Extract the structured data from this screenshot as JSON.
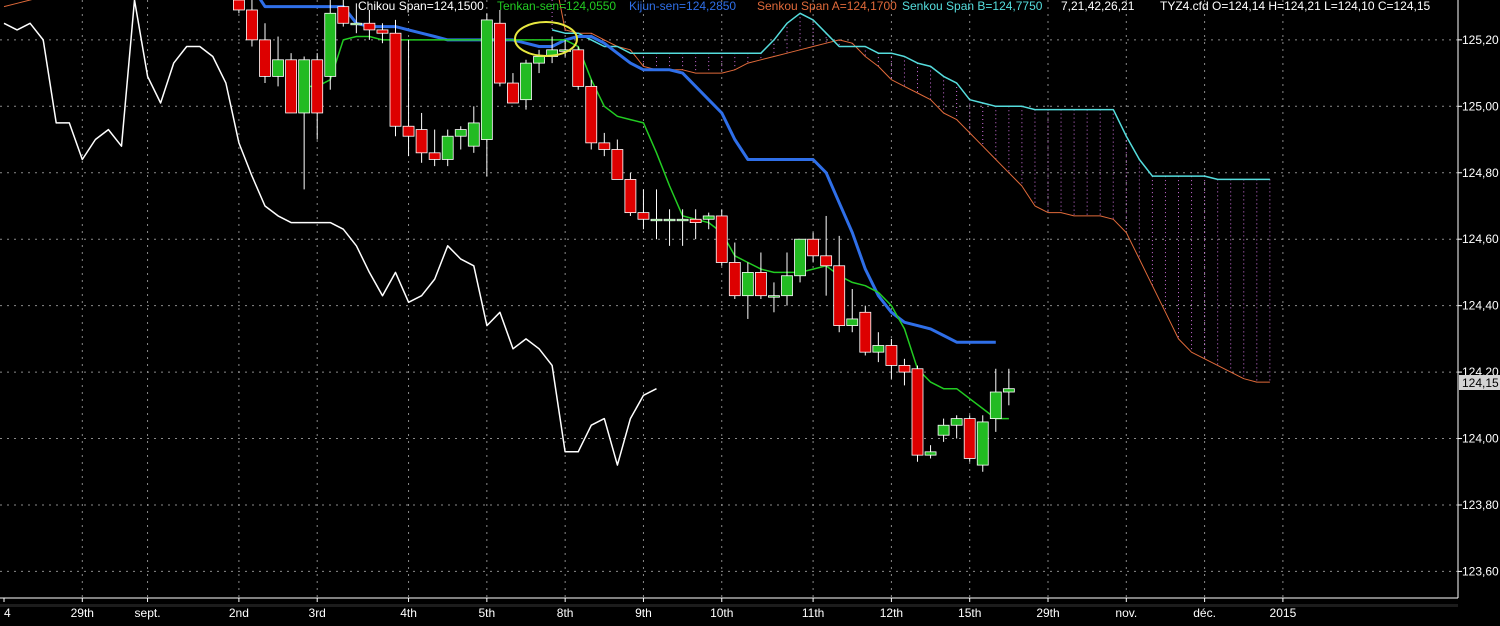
{
  "header": {
    "chikou": "Chikou Span=124,1500",
    "tenkan": "Tenkan-sen=124,0550",
    "kijun": "Kijun-sen=124,2850",
    "senkou_a": "Senkou Span A=124,1700",
    "senkou_b": "Senkou Span B=124,7750",
    "params": "7,21,42,26,21",
    "ohlc": "TYZ4.cfd O=124,14 H=124,21 L=124,10 C=124,15"
  },
  "colors": {
    "background": "#000000",
    "grid": "#8a8a8a",
    "bull": "#22bb22",
    "bear": "#dd0000",
    "chikou": "#ffffff",
    "tenkan": "#22cc22",
    "kijun": "#2f6fe8",
    "senkou_a": "#e06a3a",
    "senkou_b": "#55dddd",
    "cloud_hatch": "#d070e0",
    "annotation": "#e8e840"
  },
  "chart_data": {
    "type": "candlestick",
    "ylim": [
      123.52,
      125.32
    ],
    "y_ticks": [
      "125,20",
      "125,00",
      "124,80",
      "124,60",
      "124,40",
      "124,20",
      "124,00",
      "123,80",
      "123,60"
    ],
    "y_tick_values": [
      125.2,
      125.0,
      124.8,
      124.6,
      124.4,
      124.2,
      124.0,
      123.8,
      123.6
    ],
    "current_price_label": "124,15",
    "current_price": 124.15,
    "x_labels": [
      "4",
      "29th",
      "sept.",
      "2nd",
      "3rd",
      "4th",
      "5th",
      "8th",
      "9th",
      "10th",
      "11th",
      "12th",
      "15th",
      "29th",
      "nov.",
      "déc.",
      "2015"
    ],
    "x_label_slots": [
      0,
      6,
      11,
      18,
      24,
      31,
      37,
      43,
      49,
      55,
      62,
      68,
      74,
      80,
      86,
      92,
      98
    ],
    "candles": [
      {
        "slot": 18,
        "o": 125.32,
        "h": 125.32,
        "l": 125.28,
        "c": 125.29
      },
      {
        "slot": 19,
        "o": 125.29,
        "h": 125.32,
        "l": 125.18,
        "c": 125.2
      },
      {
        "slot": 20,
        "o": 125.2,
        "h": 125.25,
        "l": 125.07,
        "c": 125.09
      },
      {
        "slot": 21,
        "o": 125.09,
        "h": 125.21,
        "l": 125.06,
        "c": 125.14
      },
      {
        "slot": 22,
        "o": 125.14,
        "h": 125.16,
        "l": 124.98,
        "c": 124.98
      },
      {
        "slot": 23,
        "o": 124.98,
        "h": 125.15,
        "l": 124.75,
        "c": 125.14
      },
      {
        "slot": 24,
        "o": 125.14,
        "h": 125.16,
        "l": 124.9,
        "c": 124.98
      },
      {
        "slot": 25,
        "o": 125.09,
        "h": 125.32,
        "l": 125.05,
        "c": 125.28
      },
      {
        "slot": 26,
        "o": 125.3,
        "h": 125.32,
        "l": 125.24,
        "c": 125.25
      },
      {
        "slot": 27,
        "o": 125.25,
        "h": 125.31,
        "l": 125.22,
        "c": 125.25
      },
      {
        "slot": 28,
        "o": 125.25,
        "h": 125.29,
        "l": 125.2,
        "c": 125.23
      },
      {
        "slot": 29,
        "o": 125.23,
        "h": 125.25,
        "l": 125.19,
        "c": 125.22
      },
      {
        "slot": 30,
        "o": 125.22,
        "h": 125.26,
        "l": 124.91,
        "c": 124.94
      },
      {
        "slot": 31,
        "o": 124.94,
        "h": 125.2,
        "l": 124.85,
        "c": 124.91
      },
      {
        "slot": 32,
        "o": 124.93,
        "h": 124.98,
        "l": 124.83,
        "c": 124.86
      },
      {
        "slot": 33,
        "o": 124.86,
        "h": 124.93,
        "l": 124.82,
        "c": 124.84
      },
      {
        "slot": 34,
        "o": 124.84,
        "h": 124.93,
        "l": 124.82,
        "c": 124.91
      },
      {
        "slot": 35,
        "o": 124.91,
        "h": 124.94,
        "l": 124.87,
        "c": 124.93
      },
      {
        "slot": 36,
        "o": 124.88,
        "h": 125.0,
        "l": 124.86,
        "c": 124.95
      },
      {
        "slot": 37,
        "o": 124.9,
        "h": 125.28,
        "l": 124.79,
        "c": 125.26
      },
      {
        "slot": 38,
        "o": 125.25,
        "h": 125.29,
        "l": 125.06,
        "c": 125.07
      },
      {
        "slot": 39,
        "o": 125.07,
        "h": 125.1,
        "l": 125.01,
        "c": 125.01
      },
      {
        "slot": 40,
        "o": 125.02,
        "h": 125.14,
        "l": 124.99,
        "c": 125.13
      },
      {
        "slot": 41,
        "o": 125.13,
        "h": 125.17,
        "l": 125.1,
        "c": 125.15
      },
      {
        "slot": 42,
        "o": 125.15,
        "h": 125.21,
        "l": 125.13,
        "c": 125.17
      },
      {
        "slot": 43,
        "o": 125.17,
        "h": 125.2,
        "l": 125.15,
        "c": 125.17
      },
      {
        "slot": 44,
        "o": 125.17,
        "h": 125.18,
        "l": 125.05,
        "c": 125.06
      },
      {
        "slot": 45,
        "o": 125.06,
        "h": 125.08,
        "l": 124.87,
        "c": 124.89
      },
      {
        "slot": 46,
        "o": 124.89,
        "h": 124.92,
        "l": 124.85,
        "c": 124.87
      },
      {
        "slot": 47,
        "o": 124.87,
        "h": 124.9,
        "l": 124.78,
        "c": 124.78
      },
      {
        "slot": 48,
        "o": 124.78,
        "h": 124.8,
        "l": 124.67,
        "c": 124.68
      },
      {
        "slot": 49,
        "o": 124.68,
        "h": 124.75,
        "l": 124.63,
        "c": 124.66
      },
      {
        "slot": 50,
        "o": 124.66,
        "h": 124.75,
        "l": 124.6,
        "c": 124.66
      },
      {
        "slot": 51,
        "o": 124.66,
        "h": 124.69,
        "l": 124.58,
        "c": 124.66
      },
      {
        "slot": 52,
        "o": 124.66,
        "h": 124.69,
        "l": 124.58,
        "c": 124.66
      },
      {
        "slot": 53,
        "o": 124.66,
        "h": 124.69,
        "l": 124.6,
        "c": 124.65
      },
      {
        "slot": 54,
        "o": 124.66,
        "h": 124.68,
        "l": 124.63,
        "c": 124.67
      },
      {
        "slot": 55,
        "o": 124.67,
        "h": 124.69,
        "l": 124.52,
        "c": 124.53
      },
      {
        "slot": 56,
        "o": 124.53,
        "h": 124.59,
        "l": 124.42,
        "c": 124.43
      },
      {
        "slot": 57,
        "o": 124.43,
        "h": 124.53,
        "l": 124.36,
        "c": 124.5
      },
      {
        "slot": 58,
        "o": 124.5,
        "h": 124.56,
        "l": 124.42,
        "c": 124.43
      },
      {
        "slot": 59,
        "o": 124.43,
        "h": 124.47,
        "l": 124.38,
        "c": 124.43
      },
      {
        "slot": 60,
        "o": 124.43,
        "h": 124.56,
        "l": 124.4,
        "c": 124.49
      },
      {
        "slot": 61,
        "o": 124.49,
        "h": 124.6,
        "l": 124.47,
        "c": 124.6
      },
      {
        "slot": 62,
        "o": 124.6,
        "h": 124.62,
        "l": 124.53,
        "c": 124.55
      },
      {
        "slot": 63,
        "o": 124.55,
        "h": 124.67,
        "l": 124.43,
        "c": 124.52
      },
      {
        "slot": 64,
        "o": 124.52,
        "h": 124.61,
        "l": 124.32,
        "c": 124.34
      },
      {
        "slot": 65,
        "o": 124.34,
        "h": 124.45,
        "l": 124.32,
        "c": 124.36
      },
      {
        "slot": 66,
        "o": 124.38,
        "h": 124.4,
        "l": 124.25,
        "c": 124.26
      },
      {
        "slot": 67,
        "o": 124.26,
        "h": 124.32,
        "l": 124.23,
        "c": 124.28
      },
      {
        "slot": 68,
        "o": 124.28,
        "h": 124.3,
        "l": 124.18,
        "c": 124.22
      },
      {
        "slot": 69,
        "o": 124.22,
        "h": 124.24,
        "l": 124.16,
        "c": 124.2
      },
      {
        "slot": 70,
        "o": 124.21,
        "h": 124.22,
        "l": 123.93,
        "c": 123.95
      },
      {
        "slot": 71,
        "o": 123.95,
        "h": 123.98,
        "l": 123.94,
        "c": 123.96
      },
      {
        "slot": 72,
        "o": 124.01,
        "h": 124.06,
        "l": 123.99,
        "c": 124.04
      },
      {
        "slot": 73,
        "o": 124.04,
        "h": 124.07,
        "l": 124.0,
        "c": 124.06
      },
      {
        "slot": 74,
        "o": 124.06,
        "h": 124.07,
        "l": 123.93,
        "c": 123.94
      },
      {
        "slot": 75,
        "o": 123.92,
        "h": 124.07,
        "l": 123.9,
        "c": 124.05
      },
      {
        "slot": 76,
        "o": 124.06,
        "h": 124.21,
        "l": 124.02,
        "c": 124.14
      },
      {
        "slot": 77,
        "o": 124.14,
        "h": 124.21,
        "l": 124.1,
        "c": 124.15
      }
    ],
    "chikou": {
      "start_slot": 0,
      "values": [
        125.25,
        125.23,
        125.25,
        125.2,
        124.95,
        124.95,
        124.84,
        124.9,
        124.93,
        124.88,
        125.32,
        125.09,
        125.01,
        125.13,
        125.18,
        125.18,
        125.15,
        125.07,
        124.89,
        124.79,
        124.7,
        124.67,
        124.65,
        124.65,
        124.65,
        124.65,
        124.63,
        124.58,
        124.5,
        124.43,
        124.5,
        124.41,
        124.43,
        124.48,
        124.58,
        124.54,
        124.52,
        124.34,
        124.38,
        124.27,
        124.3,
        124.27,
        124.22,
        123.96,
        123.96,
        124.04,
        124.06,
        123.92,
        124.06,
        124.13,
        124.15
      ]
    },
    "tenkan": {
      "start_slot": 23,
      "values": [
        125.06,
        125.06,
        125.08,
        125.2,
        125.21,
        125.21,
        125.2,
        125.2,
        125.2,
        125.2,
        125.2,
        125.2,
        125.2,
        125.2,
        125.2,
        125.2,
        125.2,
        125.2,
        125.2,
        125.2,
        125.2,
        125.18,
        125.08,
        125.0,
        124.97,
        124.96,
        124.95,
        124.86,
        124.76,
        124.67,
        124.66,
        124.65,
        124.62,
        124.55,
        124.53,
        124.51,
        124.5,
        124.5,
        124.5,
        124.51,
        124.52,
        124.49,
        124.47,
        124.46,
        124.44,
        124.4,
        124.33,
        124.21,
        124.17,
        124.15,
        124.15,
        124.12,
        124.09,
        124.06,
        124.06
      ]
    },
    "kijun": {
      "start_slot": 18,
      "values": [
        125.42,
        125.36,
        125.3,
        125.3,
        125.3,
        125.3,
        125.3,
        125.3,
        125.3,
        125.25,
        125.24,
        125.24,
        125.24,
        125.23,
        125.22,
        125.21,
        125.2,
        125.2,
        125.2,
        125.2,
        125.2,
        125.2,
        125.19,
        125.18,
        125.18,
        125.2,
        125.21,
        125.21,
        125.19,
        125.16,
        125.13,
        125.11,
        125.11,
        125.11,
        125.1,
        125.06,
        125.02,
        124.98,
        124.9,
        124.84,
        124.84,
        124.84,
        124.84,
        124.84,
        124.84,
        124.8,
        124.71,
        124.62,
        124.51,
        124.43,
        124.38,
        124.35,
        124.34,
        124.33,
        124.31,
        124.29,
        124.29,
        124.29,
        124.29
      ]
    },
    "senkou_a": {
      "start_slot": 0,
      "values": [
        125.3,
        125.31,
        125.32,
        125.33,
        125.34,
        125.36,
        125.38,
        125.4,
        125.42,
        125.43,
        125.44,
        125.45,
        125.45,
        125.45,
        125.45,
        125.45,
        125.45,
        125.45,
        125.45,
        125.45,
        125.45,
        125.45,
        125.45,
        125.45,
        125.45,
        125.45,
        125.45,
        125.45,
        125.45,
        125.45,
        125.45,
        125.45,
        125.45,
        125.45,
        125.45,
        125.45,
        125.45,
        125.45,
        125.45,
        125.45,
        125.44,
        125.44,
        125.43,
        125.23,
        125.22,
        125.22,
        125.2,
        125.18,
        125.17,
        125.12,
        125.11,
        125.11,
        125.11,
        125.1,
        125.1,
        125.1,
        125.11,
        125.13,
        125.14,
        125.15,
        125.16,
        125.17,
        125.18,
        125.19,
        125.2,
        125.19,
        125.15,
        125.12,
        125.08,
        125.06,
        125.04,
        125.02,
        124.98,
        124.96,
        124.92,
        124.88,
        124.84,
        124.8,
        124.76,
        124.7,
        124.68,
        124.68,
        124.67,
        124.67,
        124.67,
        124.66,
        124.62,
        124.54,
        124.46,
        124.38,
        124.3,
        124.26,
        124.24,
        124.22,
        124.2,
        124.18,
        124.17,
        124.17
      ]
    },
    "senkou_b": {
      "start_slot": 42,
      "values": [
        125.23,
        125.22,
        125.22,
        125.2,
        125.18,
        125.18,
        125.16,
        125.16,
        125.16,
        125.16,
        125.16,
        125.16,
        125.16,
        125.16,
        125.16,
        125.16,
        125.16,
        125.2,
        125.25,
        125.28,
        125.26,
        125.22,
        125.18,
        125.18,
        125.18,
        125.16,
        125.16,
        125.15,
        125.13,
        125.12,
        125.09,
        125.07,
        125.02,
        125.01,
        125.0,
        125.0,
        125.0,
        124.99,
        124.99,
        124.99,
        124.99,
        124.99,
        124.99,
        124.99,
        124.91,
        124.84,
        124.79,
        124.79,
        124.79,
        124.79,
        124.79,
        124.78,
        124.78,
        124.78,
        124.78,
        124.78
      ]
    }
  }
}
